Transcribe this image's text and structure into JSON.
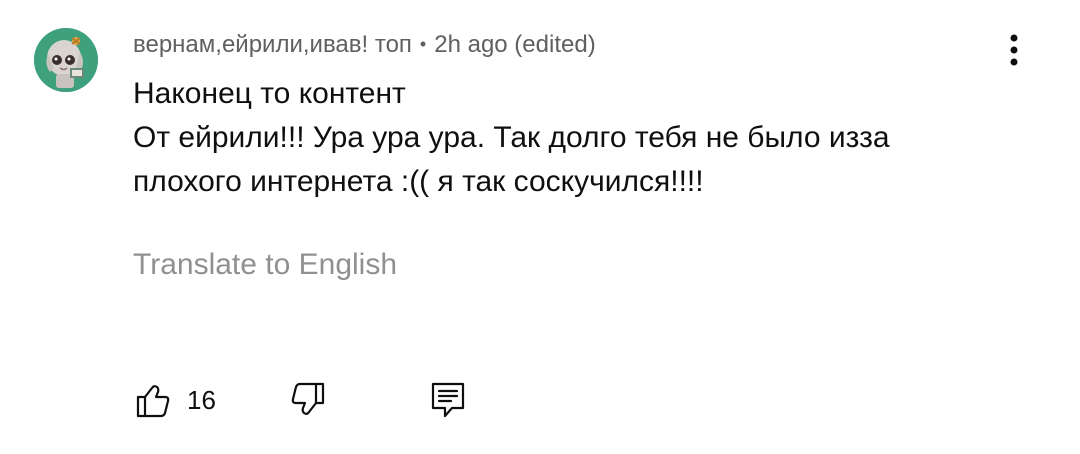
{
  "comment": {
    "author": "вернам,ейрили,ивав! топ",
    "separator": "•",
    "timestamp": "2h ago (edited)",
    "lines": [
      "Наконец то контент",
      "От ейрили!!! Ура ура ура. Так долго тебя не было изза",
      "плохого интернета :(( я так соскучился!!!!"
    ],
    "translate_label": "Translate to English",
    "like_count": "16"
  },
  "icons": {
    "avatar": "avatar-cartoon",
    "menu": "more-vertical-icon",
    "like": "thumbs-up-icon",
    "dislike": "thumbs-down-icon",
    "reply": "reply-comment-icon"
  },
  "colors": {
    "avatar_bg": "#3fa07e",
    "meta_text": "#606060",
    "translate_text": "#909090",
    "text": "#0f0f0f"
  }
}
